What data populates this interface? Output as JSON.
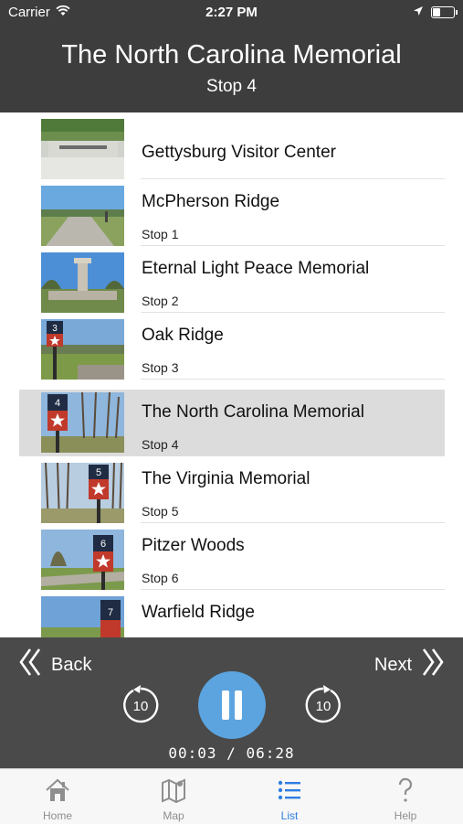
{
  "status_bar": {
    "carrier": "Carrier",
    "time": "2:27 PM"
  },
  "header": {
    "title": "The North Carolina Memorial",
    "subtitle": "Stop 4"
  },
  "stops": [
    {
      "title": "Gettysburg Visitor Center",
      "subtitle": ""
    },
    {
      "title": "McPherson Ridge",
      "subtitle": "Stop 1"
    },
    {
      "title": "Eternal Light Peace Memorial",
      "subtitle": "Stop 2"
    },
    {
      "title": "Oak Ridge",
      "subtitle": "Stop 3",
      "sign": "3"
    },
    {
      "title": "The North Carolina Memorial",
      "subtitle": "Stop 4",
      "sign": "4",
      "selected": true
    },
    {
      "title": "The Virginia Memorial",
      "subtitle": "Stop 5",
      "sign": "5"
    },
    {
      "title": "Pitzer Woods",
      "subtitle": "Stop 6",
      "sign": "6"
    },
    {
      "title": "Warfield Ridge",
      "subtitle": "",
      "sign": "7"
    }
  ],
  "player": {
    "back_label": "Back",
    "next_label": "Next",
    "skip_back_seconds": "10",
    "skip_forward_seconds": "10",
    "elapsed": "00:03",
    "separator": "/",
    "duration": "06:28",
    "accent_color": "#5ba4e0"
  },
  "tabs": [
    {
      "label": "Home",
      "icon": "home-icon"
    },
    {
      "label": "Map",
      "icon": "map-icon"
    },
    {
      "label": "List",
      "icon": "list-icon",
      "active": true
    },
    {
      "label": "Help",
      "icon": "help-icon"
    }
  ]
}
